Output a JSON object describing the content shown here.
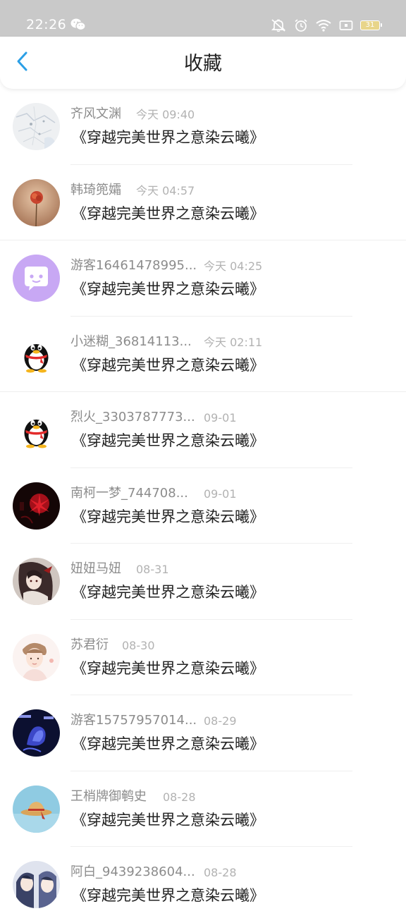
{
  "status_bar": {
    "time": "22:26",
    "battery": "31",
    "icons": [
      "wechat-icon",
      "mute-icon",
      "alarm-icon",
      "wifi-icon",
      "screen-icon",
      "battery-icon"
    ]
  },
  "header": {
    "title": "收藏",
    "back_icon": "chevron-left-icon"
  },
  "colors": {
    "accent": "#2b9fe6",
    "status_bar_bg": "#c9c9c9"
  },
  "items": [
    {
      "name": "齐风文渊",
      "time": "今天 09:40",
      "title": "《穿越完美世界之意染云曦》",
      "avatar": "map-avatar"
    },
    {
      "name": "韩琦篼孀",
      "time": "今天 04:57",
      "title": "《穿越完美世界之意染云曦》",
      "avatar": "flower-avatar"
    },
    {
      "name": "游客16461478995...",
      "time": "今天 04:25",
      "title": "《穿越完美世界之意染云曦》",
      "avatar": "purple-chat-avatar"
    },
    {
      "name": "小迷糊_36814113...",
      "time": "今天 02:11",
      "title": "《穿越完美世界之意染云曦》",
      "avatar": "penguin-avatar"
    },
    {
      "name": "烈火_3303787773...",
      "time": "09-01",
      "title": "《穿越完美世界之意染云曦》",
      "avatar": "penguin-avatar"
    },
    {
      "name": "南柯一梦_744708...",
      "time": "09-01",
      "title": "《穿越完美世界之意染云曦》",
      "avatar": "red-flower-avatar"
    },
    {
      "name": "妞妞马妞",
      "time": "08-31",
      "title": "《穿越完美世界之意染云曦》",
      "avatar": "anime-avatar"
    },
    {
      "name": "苏君衍",
      "time": "08-30",
      "title": "《穿越完美世界之意染云曦》",
      "avatar": "portrait-avatar"
    },
    {
      "name": "游客15757957014...",
      "time": "08-29",
      "title": "《穿越完美世界之意染云曦》",
      "avatar": "blue-flower-avatar"
    },
    {
      "name": "王梢牌御鹌史",
      "time": "08-28",
      "title": "《穿越完美世界之意染云曦》",
      "avatar": "straw-hat-avatar"
    },
    {
      "name": "阿白_9439238604...",
      "time": "08-28",
      "title": "《穿越完美世界之意染云曦》",
      "avatar": "anime-boys-avatar"
    }
  ]
}
